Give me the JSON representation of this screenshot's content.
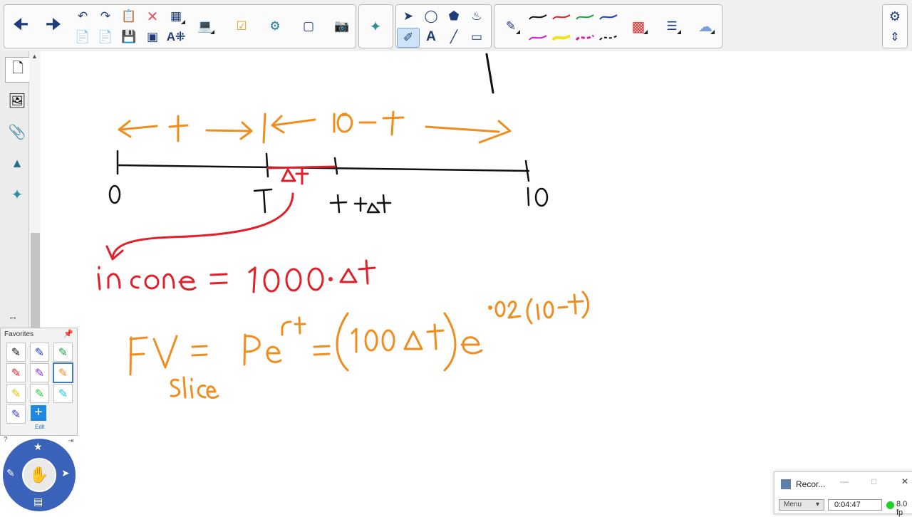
{
  "toolbar": {
    "groups": [
      "navigation",
      "page",
      "tools",
      "pens",
      "settings"
    ]
  },
  "sidebar": {
    "items": [
      "page-sorter",
      "gallery",
      "attachments",
      "properties",
      "add-ons"
    ]
  },
  "favorites": {
    "title": "Favorites",
    "edit_label": "Edit"
  },
  "colors": {
    "orange": "#ef8d1f",
    "red": "#e2202a",
    "black": "#111111",
    "accent": "#3b62b9"
  },
  "recorder": {
    "title": "Recor...",
    "menu_label": "Menu",
    "elapsed": "0:04:47",
    "fps": "8.0 fp"
  }
}
